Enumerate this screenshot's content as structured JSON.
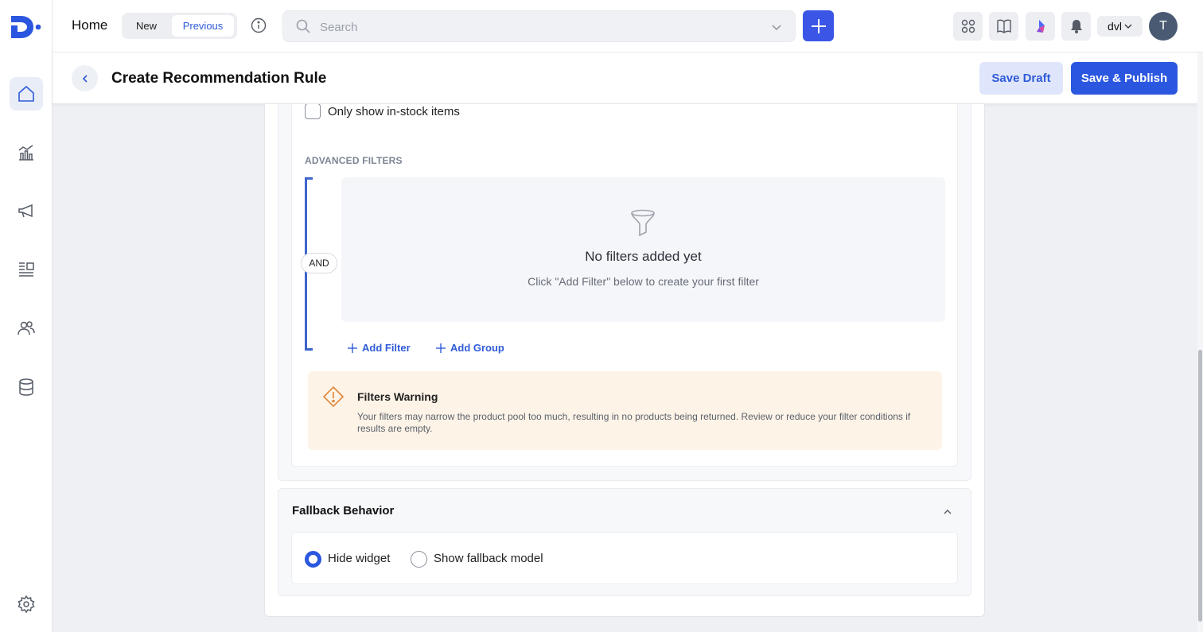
{
  "topbar": {
    "home_label": "Home",
    "toggle": {
      "new_label": "New",
      "previous_label": "Previous",
      "selected": "Previous"
    },
    "search_placeholder": "Search",
    "workspace_label": "dvl",
    "avatar_initial": "T"
  },
  "sidebar": {
    "items": [
      {
        "name": "home",
        "icon": "home-icon",
        "active": true
      },
      {
        "name": "analytics",
        "icon": "chart-icon"
      },
      {
        "name": "campaigns",
        "icon": "megaphone-icon"
      },
      {
        "name": "catalog",
        "icon": "list-icon"
      },
      {
        "name": "audiences",
        "icon": "users-icon"
      },
      {
        "name": "data",
        "icon": "database-icon"
      }
    ],
    "settings_icon": "gear-icon"
  },
  "header": {
    "title": "Create Recommendation Rule",
    "save_draft_label": "Save Draft",
    "publish_label": "Save & Publish"
  },
  "filters": {
    "in_stock_label": "Only show in-stock items",
    "in_stock_checked": false,
    "advanced_title": "ADVANCED FILTERS",
    "logic_operator": "AND",
    "empty_title": "No filters added yet",
    "empty_subtitle": "Click \"Add Filter\" below to create your first filter",
    "add_filter_label": "Add Filter",
    "add_group_label": "Add Group",
    "warning": {
      "title": "Filters Warning",
      "text": "Your filters may narrow the product pool too much, resulting in no products being returned. Review or reduce your filter conditions if results are empty."
    }
  },
  "fallback": {
    "title": "Fallback Behavior",
    "options": [
      {
        "label": "Hide widget",
        "selected": true
      },
      {
        "label": "Show fallback model",
        "selected": false
      }
    ]
  },
  "colors": {
    "primary": "#2b57e0",
    "warning_bg": "#fdf3e7",
    "warning_icon": "#e0873a",
    "bracket": "#3f64cc"
  }
}
